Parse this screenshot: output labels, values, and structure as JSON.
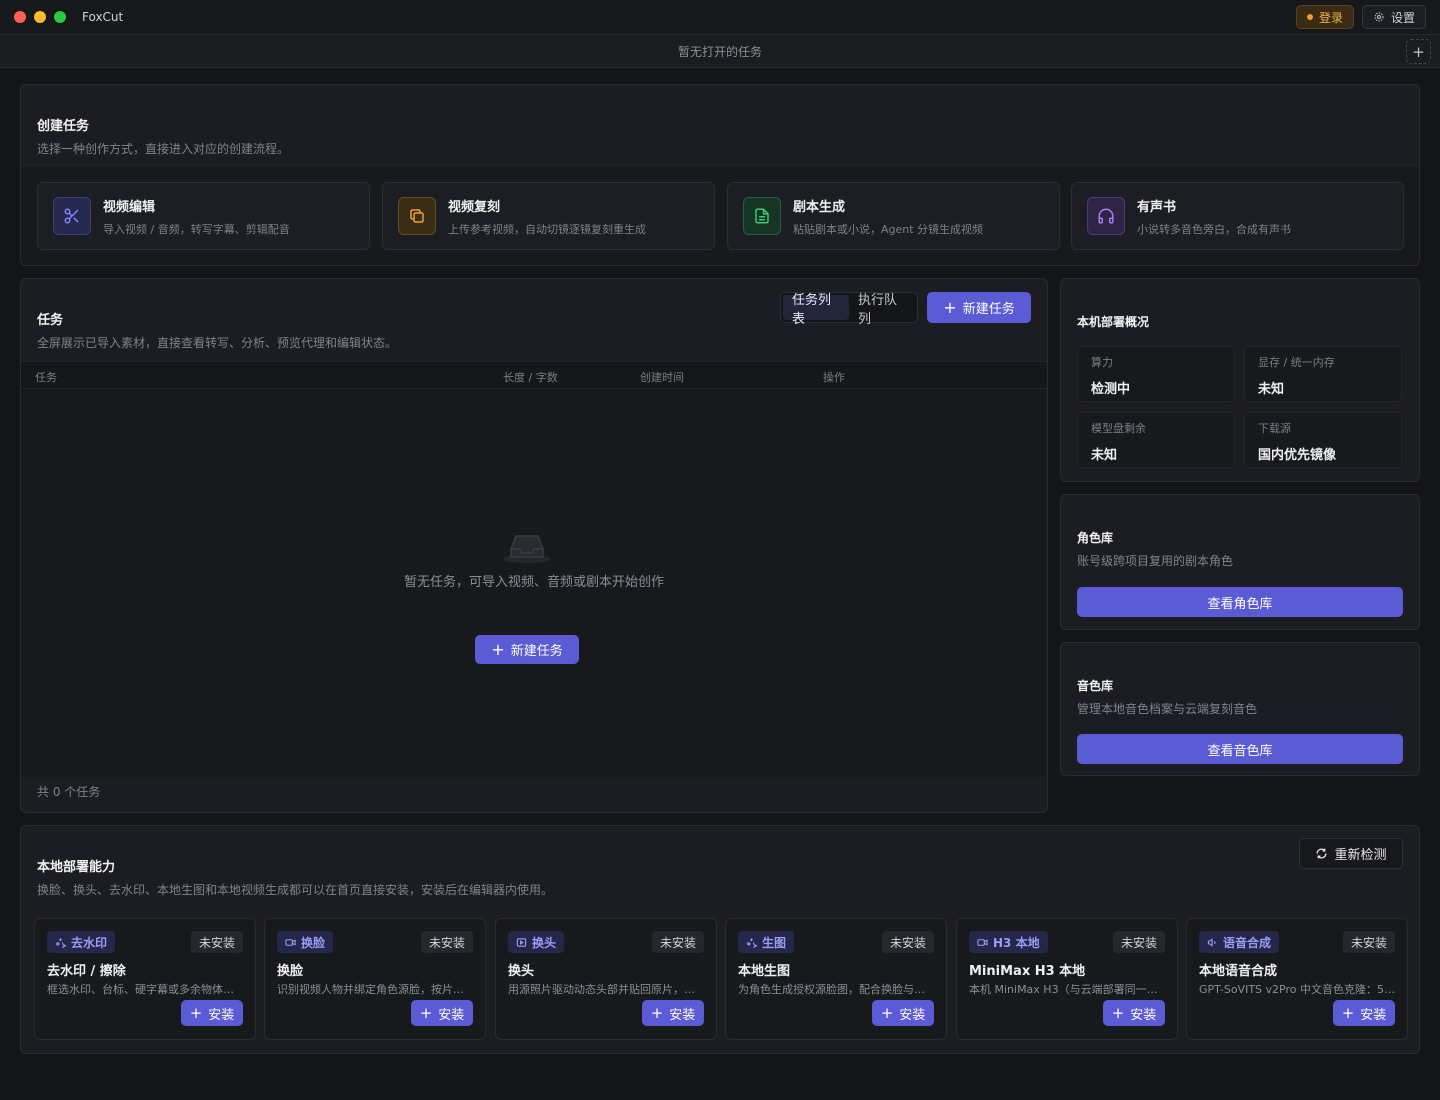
{
  "window": {
    "app_name": "FoxCut",
    "login_label": "登录",
    "settings_label": "设置"
  },
  "tabbar": {
    "empty_text": "暂无打开的任务",
    "add_label": "+"
  },
  "create": {
    "title": "创建任务",
    "subtitle": "选择一种创作方式，直接进入对应的创建流程。",
    "cards": [
      {
        "title": "视频编辑",
        "desc": "导入视频 / 音频，转写字幕、剪辑配音",
        "icon": "scissors-icon",
        "color": "#7f83ff"
      },
      {
        "title": "视频复刻",
        "desc": "上传参考视频，自动切镜逐镜复刻重生成",
        "icon": "copy-icon",
        "color": "#f0a030"
      },
      {
        "title": "剧本生成",
        "desc": "粘贴剧本或小说，Agent 分镜生成视频",
        "icon": "file-icon",
        "color": "#3ec97a"
      },
      {
        "title": "有声书",
        "desc": "小说转多音色旁白，合成有声书",
        "icon": "headphones-icon",
        "color": "#a77df5"
      }
    ]
  },
  "tasks": {
    "title": "任务",
    "subtitle": "全屏展示已导入素材，直接查看转写、分析、预览代理和编辑状态。",
    "seg_list": "任务列表",
    "seg_queue": "执行队列",
    "new_task": "新建任务",
    "columns": [
      "任务",
      "长度 / 字数",
      "创建时间",
      "操作"
    ],
    "empty_text": "暂无任务，可导入视频、音频或剧本开始创作",
    "empty_new_task": "新建任务",
    "footer": "共 0 个任务"
  },
  "deploy": {
    "title": "本机部署概况",
    "stats": [
      {
        "label": "算力",
        "value": "检测中"
      },
      {
        "label": "显存 / 统一内存",
        "value": "未知"
      },
      {
        "label": "模型盘剩余",
        "value": "未知"
      },
      {
        "label": "下载源",
        "value": "国内优先镜像"
      }
    ]
  },
  "roles": {
    "title": "角色库",
    "subtitle": "账号级跨项目复用的剧本角色",
    "button": "查看角色库"
  },
  "voices": {
    "title": "音色库",
    "subtitle": "管理本地音色档案与云端复刻音色",
    "button": "查看音色库"
  },
  "capabilities": {
    "title": "本地部署能力",
    "subtitle": "换脸、换头、去水印、本地生图和本地视频生成都可以在首页直接安装，安装后在编辑器内使用。",
    "recheck": "重新检测",
    "status_label": "未安装",
    "install_label": "安装",
    "items": [
      {
        "badge": "去水印",
        "title": "去水印 / 擦除",
        "desc": "框选水印、台标、硬字幕或多余物体，...",
        "icon": "sparkle-icon"
      },
      {
        "badge": "换脸",
        "title": "换脸",
        "desc": "识别视频人物并绑定角色源脸，按片段...",
        "icon": "video-icon"
      },
      {
        "badge": "换头",
        "title": "换头",
        "desc": "用源照片驱动动态头部并贴回原片，比...",
        "icon": "play-icon"
      },
      {
        "badge": "生图",
        "title": "本地生图",
        "desc": "为角色生成授权源脸图，配合换脸与换...",
        "icon": "sparkle-icon"
      },
      {
        "badge": "H3 本地",
        "title": "MiniMax H3 本地",
        "desc": "本机 MiniMax H3（与云端部署同一套...",
        "icon": "video-icon"
      },
      {
        "badge": "语音合成",
        "title": "本地语音合成",
        "desc": "GPT-SoVITS v2Pro 中文音色克隆：5 ...",
        "icon": "speaker-icon"
      }
    ]
  },
  "colors": {
    "accent": "#5b5bd6",
    "background": "#141519",
    "panel": "#1c1d22",
    "warning": "#f0b44c"
  }
}
